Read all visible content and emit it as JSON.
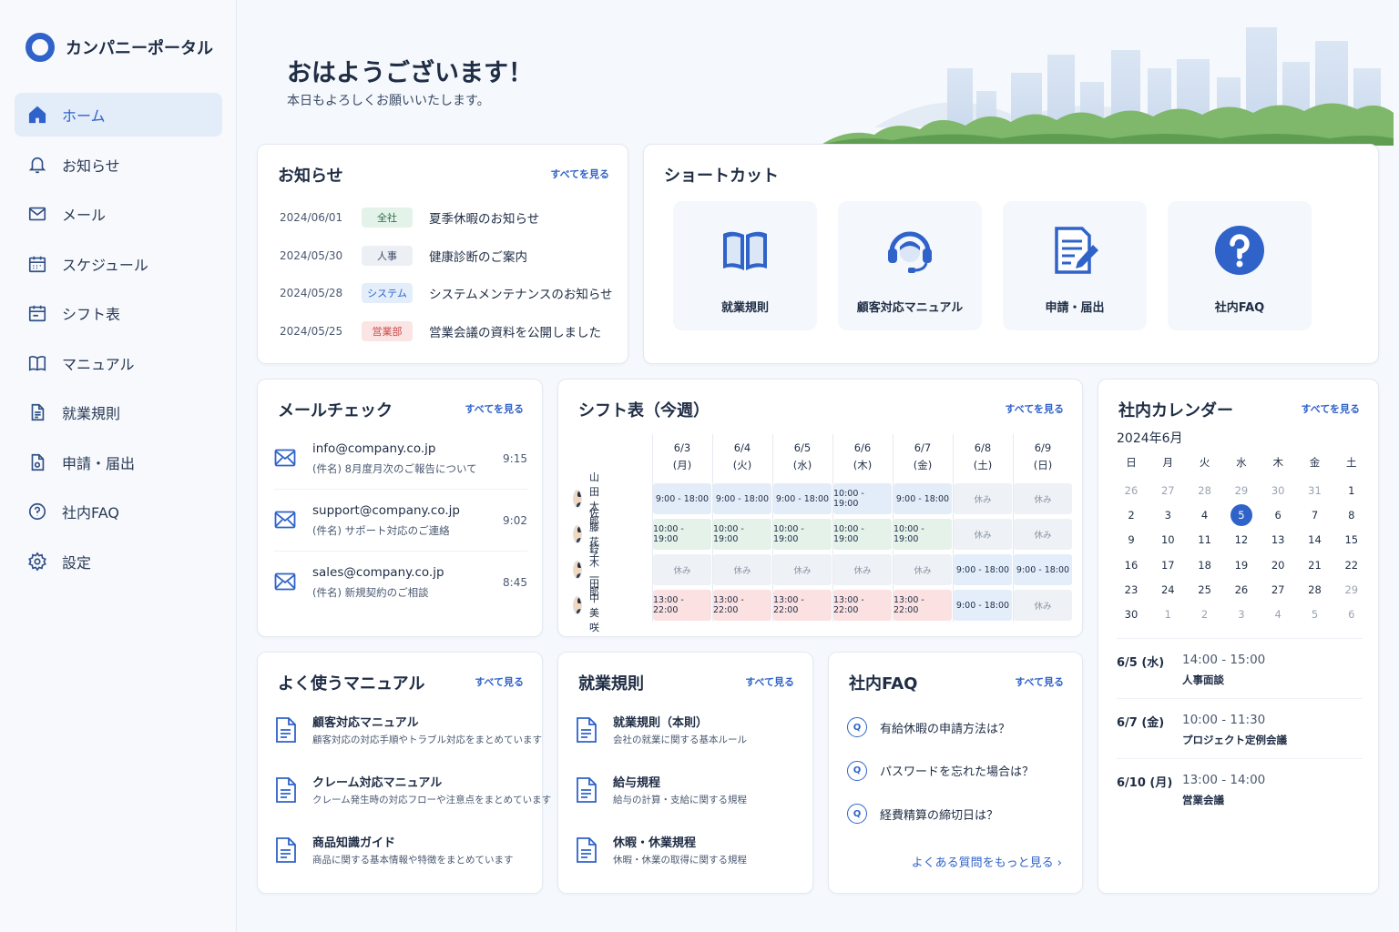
{
  "app": {
    "title": "カンパニーポータル"
  },
  "sidebar": {
    "items": [
      {
        "label": "ホーム",
        "icon": "home-icon"
      },
      {
        "label": "お知らせ",
        "icon": "bell-icon"
      },
      {
        "label": "メール",
        "icon": "mail-icon"
      },
      {
        "label": "スケジュール",
        "icon": "calendar-icon"
      },
      {
        "label": "シフト表",
        "icon": "shift-calendar-icon"
      },
      {
        "label": "マニュアル",
        "icon": "book-icon"
      },
      {
        "label": "就業規則",
        "icon": "document-icon"
      },
      {
        "label": "申請・届出",
        "icon": "form-icon"
      },
      {
        "label": "社内FAQ",
        "icon": "question-icon"
      },
      {
        "label": "設定",
        "icon": "gear-icon"
      }
    ]
  },
  "header": {
    "greeting": "おはようございます！",
    "subtitle": "本日もよろしくお願いいたします。"
  },
  "news": {
    "title": "お知らせ",
    "see_all": "すべてを見る",
    "items": [
      {
        "date": "2024/06/01",
        "tag": "全社",
        "tag_color": "#e3f3ea",
        "tag_text_color": "#2f6b45",
        "text": "夏季休暇のお知らせ"
      },
      {
        "date": "2024/05/30",
        "tag": "人事",
        "tag_color": "#eceff4",
        "tag_text_color": "#3a4a65",
        "text": "健康診断のご案内"
      },
      {
        "date": "2024/05/28",
        "tag": "システム",
        "tag_color": "#e4eefb",
        "tag_text_color": "#2f63c9",
        "text": "システムメンテナンスのお知らせ"
      },
      {
        "date": "2024/05/25",
        "tag": "営業部",
        "tag_color": "#fbe4e4",
        "tag_text_color": "#c94747",
        "text": "営業会議の資料を公開しました"
      }
    ]
  },
  "shortcuts": {
    "title": "ショートカット",
    "items": [
      {
        "label": "就業規則",
        "icon": "book-icon"
      },
      {
        "label": "顧客対応マニュアル",
        "icon": "headset-icon"
      },
      {
        "label": "申請・届出",
        "icon": "form-pen-icon"
      },
      {
        "label": "社内FAQ",
        "icon": "question-circle-icon"
      }
    ]
  },
  "mail": {
    "title": "メールチェック",
    "see_all": "すべてを見る",
    "items": [
      {
        "from": "info@company.co.jp",
        "subject": "(件名) 8月度月次のご報告について",
        "time": "9:15"
      },
      {
        "from": "support@company.co.jp",
        "subject": "(件名) サポート対応のご連絡",
        "time": "9:02"
      },
      {
        "from": "sales@company.co.jp",
        "subject": "(件名) 新規契約のご相談",
        "time": "8:45"
      }
    ]
  },
  "shift": {
    "title": "シフト表（今週）",
    "see_all": "すべてを見る",
    "days": [
      {
        "date": "6/3",
        "dow": "(月)"
      },
      {
        "date": "6/4",
        "dow": "(火)"
      },
      {
        "date": "6/5",
        "dow": "(水)"
      },
      {
        "date": "6/6",
        "dow": "(木)"
      },
      {
        "date": "6/7",
        "dow": "(金)"
      },
      {
        "date": "6/8",
        "dow": "(土)"
      },
      {
        "date": "6/9",
        "dow": "(日)"
      }
    ],
    "rows": [
      {
        "name": "山田 太郎",
        "cells": [
          "9:00 - 18:00",
          "9:00 - 18:00",
          "9:00 - 18:00",
          "10:00 - 19:00",
          "9:00 - 18:00",
          "休み",
          "休み"
        ],
        "kinds": [
          "blue",
          "blue",
          "blue",
          "blue",
          "blue",
          "off",
          "off"
        ]
      },
      {
        "name": "佐藤 花子",
        "cells": [
          "10:00 - 19:00",
          "10:00 - 19:00",
          "10:00 - 19:00",
          "10:00 - 19:00",
          "10:00 - 19:00",
          "休み",
          "休み"
        ],
        "kinds": [
          "green",
          "green",
          "green",
          "green",
          "green",
          "off",
          "off"
        ]
      },
      {
        "name": "鈴木 一郎",
        "cells": [
          "休み",
          "休み",
          "休み",
          "休み",
          "休み",
          "9:00 - 18:00",
          "9:00 - 18:00"
        ],
        "kinds": [
          "off",
          "off",
          "off",
          "off",
          "off",
          "lblue",
          "lblue"
        ]
      },
      {
        "name": "田中 美咲",
        "cells": [
          "13:00 - 22:00",
          "13:00 - 22:00",
          "13:00 - 22:00",
          "13:00 - 22:00",
          "13:00 - 22:00",
          "9:00 - 18:00",
          "休み"
        ],
        "kinds": [
          "red",
          "red",
          "red",
          "red",
          "red",
          "lblue",
          "off"
        ]
      }
    ]
  },
  "calendar": {
    "title": "社内カレンダー",
    "see_all": "すべてを見る",
    "month": "2024年6月",
    "weekdays": [
      "日",
      "月",
      "火",
      "水",
      "木",
      "金",
      "土"
    ],
    "weeks": [
      [
        "26",
        "27",
        "28",
        "29",
        "30",
        "31",
        "1"
      ],
      [
        "2",
        "3",
        "4",
        "5",
        "6",
        "7",
        "8"
      ],
      [
        "9",
        "10",
        "11",
        "12",
        "13",
        "14",
        "15"
      ],
      [
        "16",
        "17",
        "18",
        "19",
        "20",
        "21",
        "22"
      ],
      [
        "23",
        "24",
        "25",
        "26",
        "27",
        "28",
        "29"
      ],
      [
        "30",
        "1",
        "2",
        "3",
        "4",
        "5",
        "6"
      ]
    ],
    "events": [
      {
        "date": "6/5 (水)",
        "time": "14:00 - 15:00",
        "title": "人事面談"
      },
      {
        "date": "6/7 (金)",
        "time": "10:00 - 11:30",
        "title": "プロジェクト定例会議"
      },
      {
        "date": "6/10 (月)",
        "time": "13:00 - 14:00",
        "title": "営業会議"
      }
    ]
  },
  "manuals": {
    "title": "よく使うマニュアル",
    "see_all": "すべて見る",
    "items": [
      {
        "title": "顧客対応マニュアル",
        "desc": "顧客対応の対応手順やトラブル対応をまとめています"
      },
      {
        "title": "クレーム対応マニュアル",
        "desc": "クレーム発生時の対応フローや注意点をまとめています"
      },
      {
        "title": "商品知識ガイド",
        "desc": "商品に関する基本情報や特徴をまとめています"
      }
    ]
  },
  "rules": {
    "title": "就業規則",
    "see_all": "すべて見る",
    "items": [
      {
        "title": "就業規則（本則）",
        "desc": "会社の就業に関する基本ルール"
      },
      {
        "title": "給与規程",
        "desc": "給与の計算・支給に関する規程"
      },
      {
        "title": "休暇・休業規程",
        "desc": "休暇・休業の取得に関する規程"
      }
    ]
  },
  "faq": {
    "title": "社内FAQ",
    "see_all": "すべて見る",
    "q_mark": "Q",
    "items": [
      {
        "text": "有給休暇の申請方法は？"
      },
      {
        "text": "パスワードを忘れた場合は？"
      },
      {
        "text": "経費精算の締切日は？"
      }
    ],
    "more": "よくある質問をもっと見る ›"
  }
}
